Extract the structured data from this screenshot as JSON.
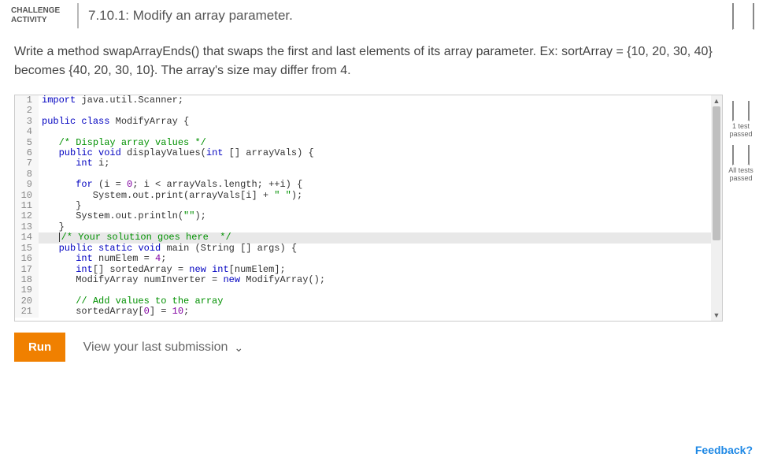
{
  "header": {
    "challenge_label_l1": "CHALLENGE",
    "challenge_label_l2": "ACTIVITY",
    "title": "7.10.1: Modify an array parameter."
  },
  "description": "Write a method swapArrayEnds() that swaps the first and last elements of its array parameter. Ex: sortArray = {10, 20, 30, 40} becomes {40, 20, 30, 10}. The array's size may differ from 4.",
  "status": {
    "one_test_l1": "1 test",
    "one_test_l2": "passed",
    "all_tests_l1": "All tests",
    "all_tests_l2": "passed"
  },
  "code": {
    "lines": [
      {
        "n": 1,
        "html": "<span class='kw'>import</span> java.util.Scanner;"
      },
      {
        "n": 2,
        "html": ""
      },
      {
        "n": 3,
        "html": "<span class='kw'>public</span> <span class='kw'>class</span> ModifyArray {"
      },
      {
        "n": 4,
        "html": ""
      },
      {
        "n": 5,
        "html": "   <span class='cm'>/* Display array values */</span>"
      },
      {
        "n": 6,
        "html": "   <span class='kw'>public</span> <span class='kw'>void</span> displayValues(<span class='kw'>int</span> [] arrayVals) {"
      },
      {
        "n": 7,
        "html": "      <span class='kw'>int</span> i;"
      },
      {
        "n": 8,
        "html": ""
      },
      {
        "n": 9,
        "html": "      <span class='kw'>for</span> (i = <span class='num'>0</span>; i &lt; arrayVals.length; ++i) {"
      },
      {
        "n": 10,
        "html": "         System.out.print(arrayVals[i] + <span class='str'>\" \"</span>);"
      },
      {
        "n": 11,
        "html": "      }"
      },
      {
        "n": 12,
        "html": "      System.out.println(<span class='str'>\"\"</span>);"
      },
      {
        "n": 13,
        "html": "   }"
      },
      {
        "n": 14,
        "html": "   <span class='cursor-bar'></span><span class='cm'>/* Your solution goes here  */</span>",
        "hl": true
      },
      {
        "n": 15,
        "html": "   <span class='kw'>public</span> <span class='kw'>static</span> <span class='kw'>void</span> main (String [] args) {"
      },
      {
        "n": 16,
        "html": "      <span class='kw'>int</span> numElem = <span class='num'>4</span>;"
      },
      {
        "n": 17,
        "html": "      <span class='kw'>int</span>[] sortedArray = <span class='kw'>new</span> <span class='kw'>int</span>[numElem];"
      },
      {
        "n": 18,
        "html": "      ModifyArray numInverter = <span class='kw'>new</span> ModifyArray();"
      },
      {
        "n": 19,
        "html": ""
      },
      {
        "n": 20,
        "html": "      <span class='cm'>// Add values to the array</span>"
      },
      {
        "n": 21,
        "html": "      sortedArray[<span class='num'>0</span>] = <span class='num'>10</span>;"
      }
    ]
  },
  "actions": {
    "run_label": "Run",
    "last_submission": "View your last submission",
    "feedback": "Feedback?"
  }
}
